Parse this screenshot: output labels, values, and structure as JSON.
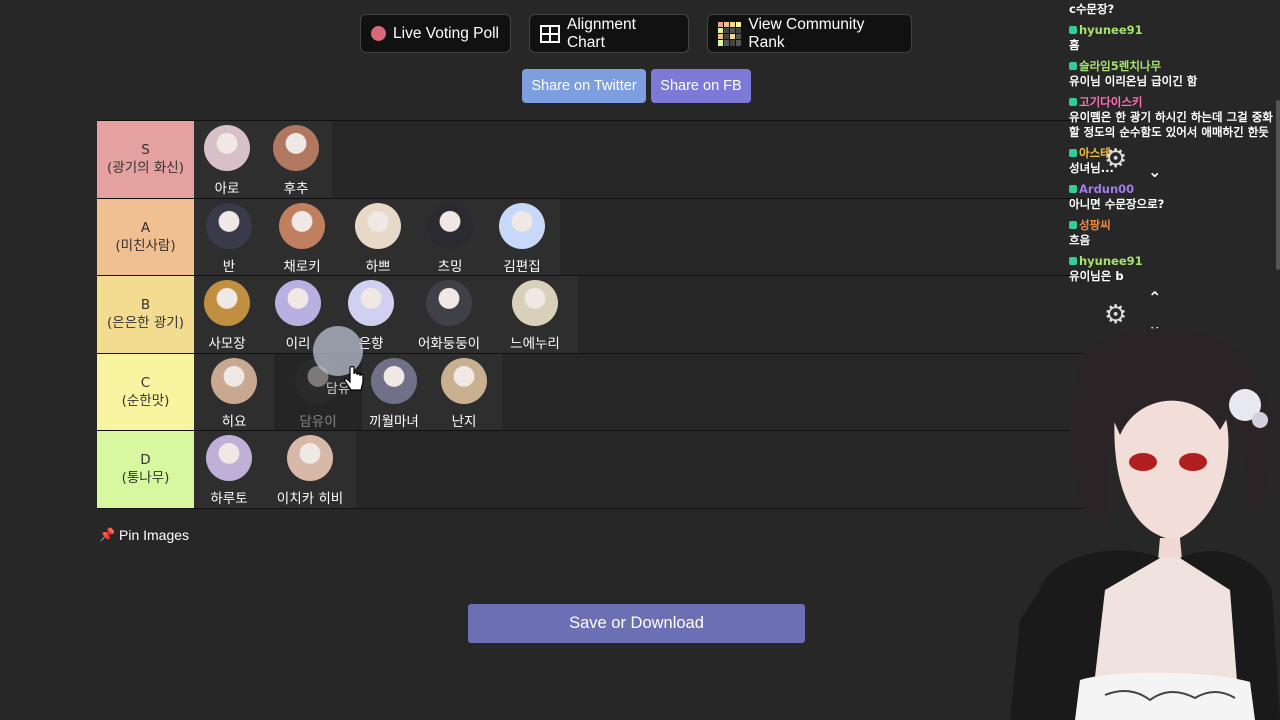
{
  "top_buttons": {
    "live_poll": "Live Voting Poll",
    "alignment": "Alignment Chart",
    "community": "View Community Rank"
  },
  "share": {
    "twitter": "Share on Twitter",
    "fb": "Share on FB"
  },
  "tiers": [
    {
      "rank": "S",
      "desc": "(광기의 화신)",
      "color": "#e5a0a0",
      "items": [
        {
          "name": "아로",
          "color": "#d8c0c8"
        },
        {
          "name": "후추",
          "color": "#b07860"
        }
      ]
    },
    {
      "rank": "A",
      "desc": "(미친사람)",
      "color": "#f0c090",
      "items": [
        {
          "name": "반",
          "color": "#3a3a4a"
        },
        {
          "name": "채로키",
          "color": "#c08060"
        },
        {
          "name": "하쁘",
          "color": "#e8d8c8"
        },
        {
          "name": "츠밍",
          "color": "#2a2a30"
        },
        {
          "name": "김편집",
          "color": "#c8d8f8"
        }
      ]
    },
    {
      "rank": "B",
      "desc": "(은은한 광기)",
      "color": "#f3dc90",
      "items": [
        {
          "name": "사모장",
          "color": "#c09040"
        },
        {
          "name": "이리",
          "color": "#b8b0e0"
        },
        {
          "name": "은향",
          "color": "#d0d0f0"
        },
        {
          "name": "어화둥둥이",
          "color": "#404048"
        },
        {
          "name": "느에누리",
          "color": "#d8d0b8"
        }
      ]
    },
    {
      "rank": "C",
      "desc": "(순한맛)",
      "color": "#f8f4a0",
      "items": [
        {
          "name": "히요",
          "color": "#c8a890"
        },
        {
          "name": "담유이",
          "color": "#3a3a3a"
        },
        {
          "name": "끼월마녀",
          "color": "#707088"
        },
        {
          "name": "난지",
          "color": "#c8b090"
        }
      ]
    },
    {
      "rank": "D",
      "desc": "(통나무)",
      "color": "#d8f8a0",
      "items": [
        {
          "name": "하루토",
          "color": "#c0b0d8"
        },
        {
          "name": "이치카 히비",
          "color": "#d8b8a8"
        }
      ]
    }
  ],
  "pin_images": "Pin Images",
  "save_download": "Save or Download",
  "dragging_label": "담유",
  "chat": [
    {
      "user": "",
      "text": "c수문장?",
      "color": "#7fd07f"
    },
    {
      "user": "hyunee91",
      "text": "흠",
      "color": "#a6e36a"
    },
    {
      "user": "슬라임5렌치나무",
      "text": "유이님 이리온님 급이긴 함",
      "color": "#a6e36a"
    },
    {
      "user": "고기다이스키",
      "text": "유이뗌은 한 광기 하시긴 하는데 그걸 중화할 정도의 순수함도 있어서 애매하긴 한듯",
      "color": "#ff6fb5"
    },
    {
      "user": "아스테",
      "text": "성녀님...",
      "color": "#f0c040"
    },
    {
      "user": "Ardun00",
      "text": "아니면 수문장으로?",
      "color": "#a07cf0"
    },
    {
      "user": "성팡씨",
      "text": "흐음",
      "color": "#f08a40"
    },
    {
      "user": "hyunee91",
      "text": "유이님은 b",
      "color": "#a6e36a"
    }
  ]
}
